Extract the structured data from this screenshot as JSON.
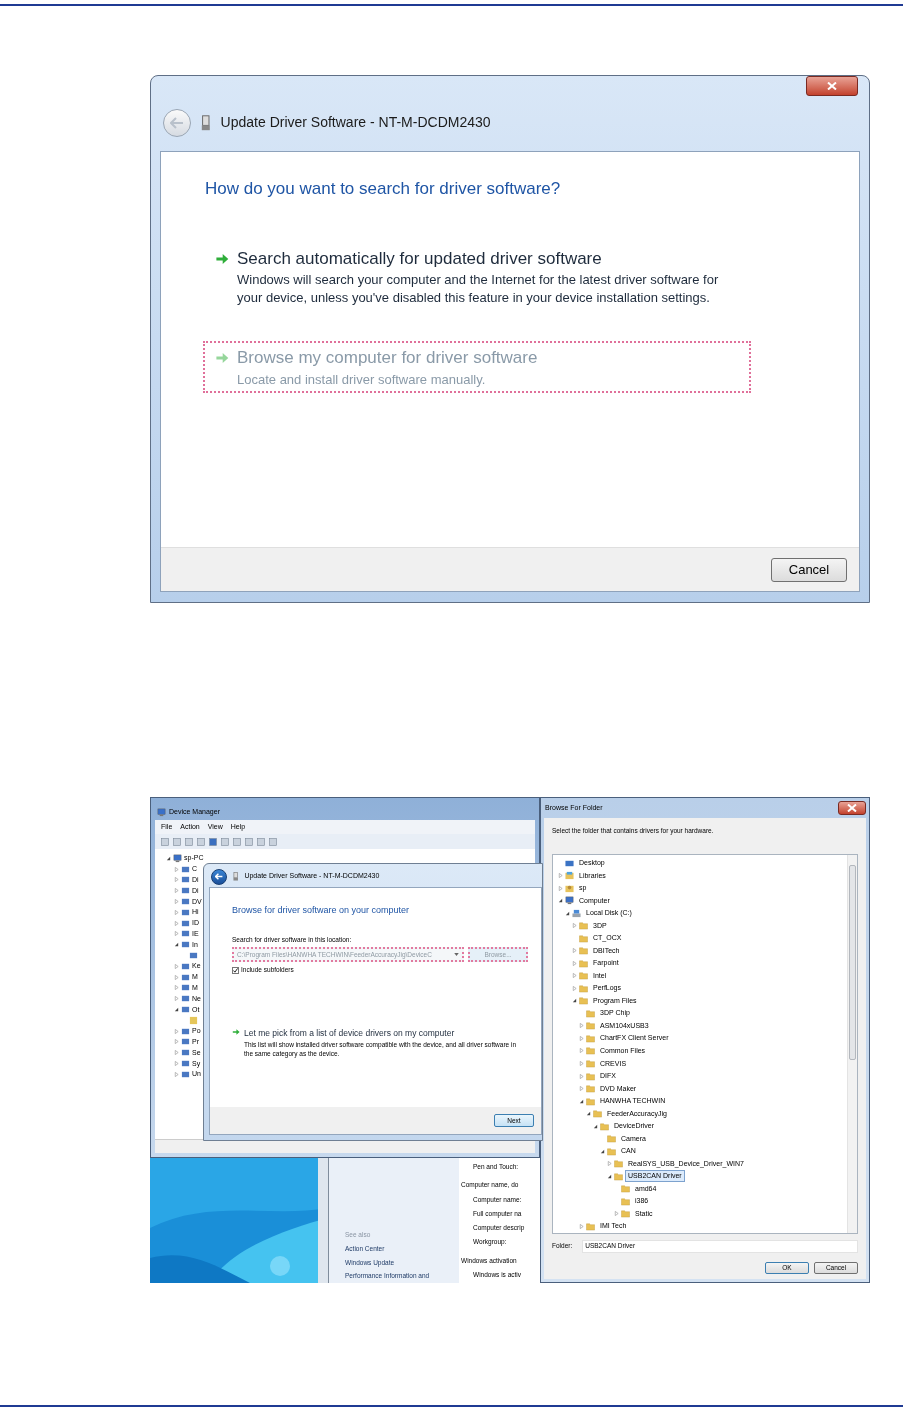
{
  "driver_dialog": {
    "title": "Update Driver Software - NT-M-DCDM2430",
    "heading": "How do you want to search for driver software?",
    "options": [
      {
        "title": "Search automatically for updated driver software",
        "description": "Windows will search your computer and the Internet for the latest driver software for your device, unless you've disabled this feature in your device installation settings.",
        "focused": false
      },
      {
        "title": "Browse my computer for driver software",
        "description": "Locate and install driver software manually.",
        "focused": true
      }
    ],
    "buttons": [
      "Cancel"
    ]
  },
  "device_manager": {
    "title": "Device Manager",
    "menu": [
      "File",
      "Action",
      "View",
      "Help"
    ],
    "tree": [
      {
        "label": "sp-PC",
        "kind": "computer",
        "expanded": true,
        "children": [
          {
            "label": "C",
            "kind": "device",
            "expanded": false
          },
          {
            "label": "Di",
            "kind": "device",
            "expanded": false
          },
          {
            "label": "Di",
            "kind": "device",
            "expanded": false
          },
          {
            "label": "DV",
            "kind": "device",
            "expanded": false
          },
          {
            "label": "Hi",
            "kind": "device",
            "expanded": false
          },
          {
            "label": "ID",
            "kind": "device",
            "expanded": false
          },
          {
            "label": "IE",
            "kind": "device",
            "expanded": false
          },
          {
            "label": "In",
            "kind": "device",
            "expanded": true,
            "children": [
              {
                "kind": "device"
              }
            ]
          },
          {
            "label": "Ke",
            "kind": "device",
            "expanded": false
          },
          {
            "label": "M",
            "kind": "device",
            "expanded": false
          },
          {
            "label": "M",
            "kind": "device",
            "expanded": false
          },
          {
            "label": "Ne",
            "kind": "device",
            "expanded": false
          },
          {
            "label": "Ot",
            "kind": "device",
            "expanded": true,
            "children": [
              {
                "kind": "warning"
              }
            ]
          },
          {
            "label": "Po",
            "kind": "device",
            "expanded": false
          },
          {
            "label": "Pr",
            "kind": "device",
            "expanded": false
          },
          {
            "label": "Se",
            "kind": "device",
            "expanded": false
          },
          {
            "label": "Sy",
            "kind": "device",
            "expanded": false
          },
          {
            "label": "Un",
            "kind": "device",
            "expanded": false
          }
        ]
      }
    ]
  },
  "update_dialog": {
    "title": "Update Driver Software - NT-M-DCDM2430",
    "heading": "Browse for driver software on your computer",
    "location_label": "Search for driver software in this location:",
    "location_value": "C:\\Program Files\\HANWHA TECHWIN\\FeederAccuracyJig\\DeviceC",
    "location_focused": true,
    "browse_button": {
      "label": "Browse...",
      "focused": true
    },
    "include_subfolders": {
      "label": "Include subfolders",
      "checked": true
    },
    "option": {
      "title": "Let me pick from a list of device drivers on my computer",
      "description": "This list will show installed driver software compatible with the device, and all driver software in the same category as the device."
    },
    "next_button": "Next"
  },
  "system_window": {
    "see_also": "See also",
    "links": [
      "Action Center",
      "Windows Update",
      "Performance Information and"
    ],
    "details": [
      {
        "text": "Pen and Touch:",
        "kind": "field"
      },
      {
        "text": "Computer name, do",
        "kind": "heading"
      },
      {
        "text": "Computer name:",
        "kind": "field"
      },
      {
        "text": "Full computer na",
        "kind": "field"
      },
      {
        "text": "Computer descrip",
        "kind": "field"
      },
      {
        "text": "Workgroup:",
        "kind": "field"
      },
      {
        "text": "Windows activation",
        "kind": "heading"
      },
      {
        "text": "Windows is activ",
        "kind": "field"
      }
    ]
  },
  "browse_dialog": {
    "title": "Browse For Folder",
    "instruction": "Select the folder that contains drivers for your hardware.",
    "tree": [
      {
        "label": "Desktop",
        "kind": "desktop",
        "selected": false
      },
      {
        "label": "Libraries",
        "kind": "libraries",
        "expanded": false,
        "selected": false
      },
      {
        "label": "sp",
        "kind": "user",
        "expanded": false,
        "selected": false
      },
      {
        "label": "Computer",
        "kind": "computer",
        "expanded": true,
        "selected": false,
        "children": [
          {
            "label": "Local Disk (C:)",
            "kind": "drive",
            "expanded": true,
            "selected": false,
            "children": [
              {
                "label": "3DP",
                "kind": "folder",
                "expanded": false,
                "selected": false
              },
              {
                "label": "CT_OCX",
                "kind": "folder",
                "selected": false
              },
              {
                "label": "DBITech",
                "kind": "folder",
                "expanded": false,
                "selected": false
              },
              {
                "label": "Farpoint",
                "kind": "folder",
                "expanded": false,
                "selected": false
              },
              {
                "label": "Intel",
                "kind": "folder",
                "expanded": false,
                "selected": false
              },
              {
                "label": "PerfLogs",
                "kind": "folder",
                "expanded": false,
                "selected": false
              },
              {
                "label": "Program Files",
                "kind": "folder",
                "expanded": true,
                "selected": false,
                "children": [
                  {
                    "label": "3DP Chip",
                    "kind": "folder",
                    "selected": false
                  },
                  {
                    "label": "ASM104xUSB3",
                    "kind": "folder",
                    "expanded": false,
                    "selected": false
                  },
                  {
                    "label": "ChartFX Client Server",
                    "kind": "folder",
                    "expanded": false,
                    "selected": false
                  },
                  {
                    "label": "Common Files",
                    "kind": "folder",
                    "expanded": false,
                    "selected": false
                  },
                  {
                    "label": "CREVIS",
                    "kind": "folder",
                    "expanded": false,
                    "selected": false
                  },
                  {
                    "label": "DIFX",
                    "kind": "folder",
                    "expanded": false,
                    "selected": false
                  },
                  {
                    "label": "DVD Maker",
                    "kind": "folder",
                    "expanded": false,
                    "selected": false
                  },
                  {
                    "label": "HANWHA TECHWIN",
                    "kind": "folder",
                    "expanded": true,
                    "selected": false,
                    "children": [
                      {
                        "label": "FeederAccuracyJig",
                        "kind": "folder",
                        "expanded": true,
                        "selected": false,
                        "children": [
                          {
                            "label": "DeviceDriver",
                            "kind": "folder",
                            "expanded": true,
                            "selected": false,
                            "children": [
                              {
                                "label": "Camera",
                                "kind": "folder",
                                "selected": false
                              },
                              {
                                "label": "CAN",
                                "kind": "folder",
                                "expanded": true,
                                "selected": false,
                                "children": [
                                  {
                                    "label": "RealSYS_USB_Device_Driver_WIN7",
                                    "kind": "folder",
                                    "expanded": false,
                                    "selected": false
                                  },
                                  {
                                    "label": "USB2CAN Driver",
                                    "kind": "folder",
                                    "expanded": true,
                                    "selected": true,
                                    "children": [
                                      {
                                        "label": "amd64",
                                        "kind": "folder",
                                        "selected": false
                                      },
                                      {
                                        "label": "i386",
                                        "kind": "folder",
                                        "selected": false
                                      },
                                      {
                                        "label": "Static",
                                        "kind": "folder",
                                        "expanded": false,
                                        "selected": false
                                      }
                                    ]
                                  }
                                ]
                              }
                            ]
                          }
                        ]
                      }
                    ]
                  },
                  {
                    "label": "IMI Tech",
                    "kind": "folder",
                    "expanded": false,
                    "selected": false
                  }
                ]
              }
            ]
          }
        ]
      }
    ],
    "folder_label": "Folder:",
    "folder_value": "USB2CAN Driver",
    "buttons": [
      "OK",
      "Cancel"
    ]
  }
}
